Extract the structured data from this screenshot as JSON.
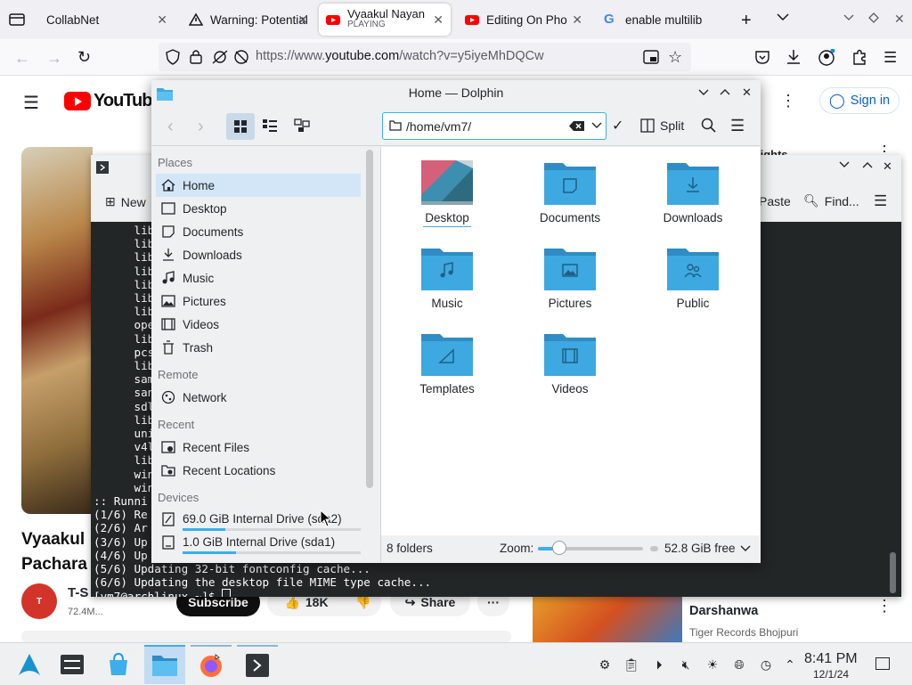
{
  "browser": {
    "tabs": [
      {
        "title": "CollabNet",
        "subtitle": ""
      },
      {
        "title": "Warning: Potential",
        "subtitle": ""
      },
      {
        "title": "Vyaakul Nayan",
        "subtitle": "PLAYING"
      },
      {
        "title": "Editing On Pho",
        "subtitle": ""
      },
      {
        "title": "enable multilib",
        "subtitle": ""
      }
    ],
    "url_prefix": "https://www.",
    "url_domain": "youtube.com",
    "url_rest": "/watch?v=y5iyeMhDQCw"
  },
  "youtube": {
    "logo": "YouTube",
    "sign_in": "Sign in",
    "video_title_line1": "Vyaakul",
    "video_title_line2": "Pachara",
    "channel": "T-S",
    "subs": "72.4M...",
    "subscribe": "Subscribe",
    "likes": "18K",
    "share": "Share",
    "lights": "lights",
    "side_title": "Darshanwa",
    "side_channel": "Tiger Records Bhojpuri"
  },
  "konsole": {
    "new_tab": "New",
    "paste": "Paste",
    "find": "Find...",
    "lines": [
      "      libg",
      "      libp",
      "      lib3",
      "      libx",
      "      lib3",
      "      libx",
      "      lib3",
      "      open",
      "      lib3",
      "      pcsc",
      "      lib3",
      "      samb",
      "      sane",
      "      sdl2",
      "      lib3",
      "      unix",
      "      v4l-",
      "      lib3",
      "      wine",
      "      wine",
      ":: Runni",
      "(1/6) Re",
      "(2/6) Ar",
      "(3/6) Up",
      "(4/6) Up",
      "(5/6) Updating 32-bit fontconfig cache...",
      "(6/6) Updating the desktop file MIME type cache...",
      "[vm7@archlinux ~]$ "
    ]
  },
  "dolphin": {
    "title": "Home — Dolphin",
    "path": "/home/vm7/",
    "split": "Split",
    "sections": {
      "places": "Places",
      "remote": "Remote",
      "recent": "Recent",
      "devices": "Devices"
    },
    "places": [
      {
        "label": "Home",
        "icon": "home-icon"
      },
      {
        "label": "Desktop",
        "icon": "desktop-icon"
      },
      {
        "label": "Documents",
        "icon": "document-icon"
      },
      {
        "label": "Downloads",
        "icon": "download-icon"
      },
      {
        "label": "Music",
        "icon": "music-icon"
      },
      {
        "label": "Pictures",
        "icon": "picture-icon"
      },
      {
        "label": "Videos",
        "icon": "video-icon"
      },
      {
        "label": "Trash",
        "icon": "trash-icon"
      }
    ],
    "remote": [
      {
        "label": "Network",
        "icon": "network-icon"
      }
    ],
    "recent": [
      {
        "label": "Recent Files",
        "icon": "recent-files-icon"
      },
      {
        "label": "Recent Locations",
        "icon": "recent-locations-icon"
      }
    ],
    "devices": [
      {
        "label": "69.0 GiB Internal Drive (sda2)",
        "usage": 0.24
      },
      {
        "label": "1.0 GiB Internal Drive (sda1)",
        "usage": 0.3
      }
    ],
    "folders": [
      {
        "label": "Desktop",
        "icon": "desktop-folder-icon"
      },
      {
        "label": "Documents",
        "icon": "documents-folder-icon"
      },
      {
        "label": "Downloads",
        "icon": "downloads-folder-icon"
      },
      {
        "label": "Music",
        "icon": "music-folder-icon"
      },
      {
        "label": "Pictures",
        "icon": "pictures-folder-icon"
      },
      {
        "label": "Public",
        "icon": "public-folder-icon"
      },
      {
        "label": "Templates",
        "icon": "templates-folder-icon"
      },
      {
        "label": "Videos",
        "icon": "videos-folder-icon"
      }
    ],
    "status": "8 folders",
    "zoom_label": "Zoom:",
    "zoom_level": 0.2,
    "free": "52.8 GiB free"
  },
  "taskbar": {
    "time": "8:41 PM",
    "date": "12/1/24"
  },
  "colors": {
    "accent": "#3daee9",
    "folder": "#3da9e0",
    "selection": "#d2e6f8"
  }
}
